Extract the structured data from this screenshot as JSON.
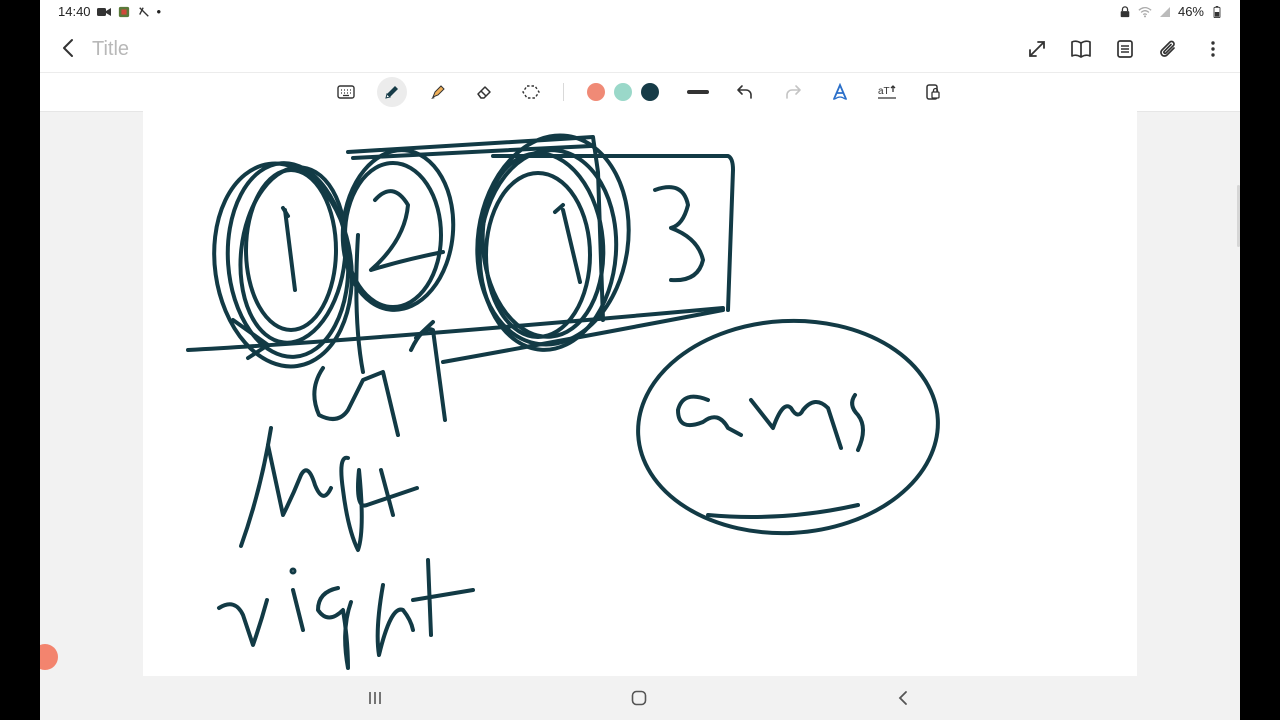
{
  "status_bar": {
    "time": "14:40",
    "battery": "46%",
    "dot": "•"
  },
  "header": {
    "title_placeholder": "Title",
    "icons": [
      "back-icon",
      "expand-icon",
      "book-view-icon",
      "page-icon",
      "attach-icon",
      "more-icon"
    ]
  },
  "toolbar": {
    "tools": [
      "keyboard-icon",
      "pen-icon",
      "highlighter-icon",
      "eraser-icon",
      "lasso-icon",
      "thickness-icon",
      "undo-icon",
      "redo-icon",
      "pen-style-icon",
      "text-convert-icon",
      "lock-icon"
    ],
    "active_tool": "pen-icon",
    "colors": [
      "#f08a76",
      "#9ad8c9",
      "#163b47"
    ]
  },
  "canvas": {
    "ink_color": "#123a45"
  }
}
